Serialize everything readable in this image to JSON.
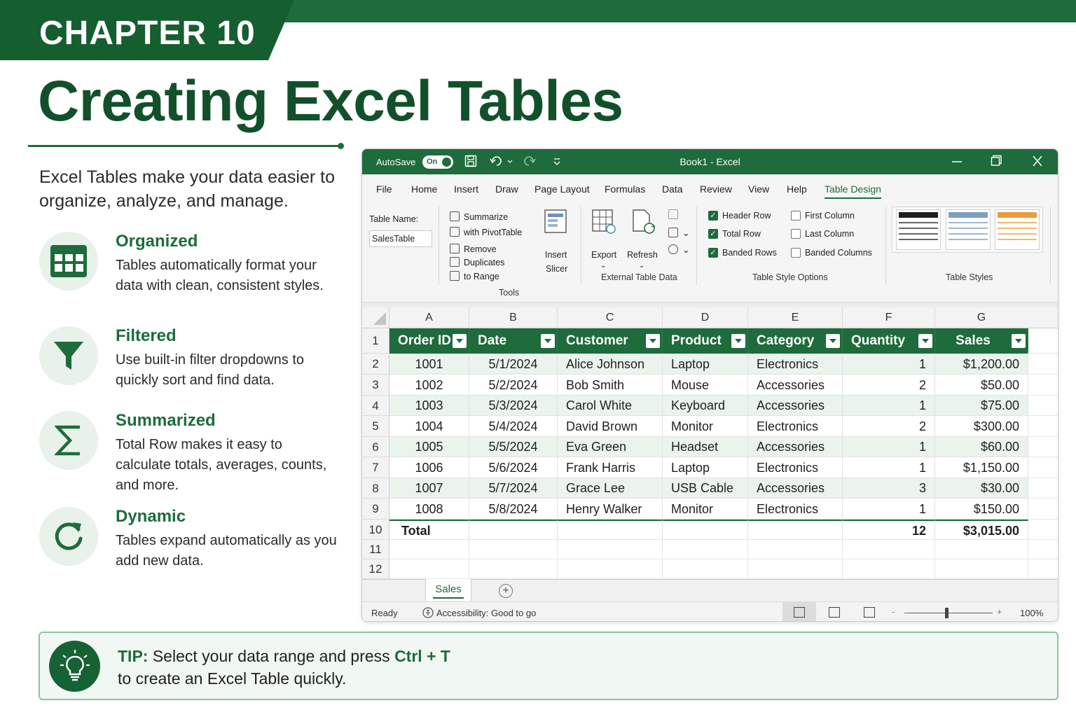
{
  "header": {
    "chapter": "CHAPTER 10",
    "title": "Creating Excel Tables"
  },
  "intro": "Excel Tables make your data easier to organize, analyze, and manage.",
  "features": [
    {
      "title": "Organized",
      "desc": "Tables automatically format your data with clean, consistent styles.",
      "icon": "table-grid-icon"
    },
    {
      "title": "Filtered",
      "desc": "Use built-in filter dropdowns to quickly sort and find data.",
      "icon": "filter-funnel-icon"
    },
    {
      "title": "Summarized",
      "desc": "Total Row makes it easy to calculate totals, averages, counts, and more.",
      "icon": "sigma-icon"
    },
    {
      "title": "Dynamic",
      "desc": "Tables expand automatically as you add new data.",
      "icon": "refresh-icon"
    }
  ],
  "excel": {
    "autosave_label": "AutoSave",
    "autosave_state": "On",
    "doc_title": "Book1  -  Excel",
    "menu": [
      "File",
      "Home",
      "Insert",
      "Draw",
      "Page Layout",
      "Formulas",
      "Data",
      "Review",
      "View",
      "Help",
      "Table Design"
    ],
    "active_menu": "Table Design",
    "ribbon": {
      "table_name_label": "Table Name:",
      "table_name_value": "SalesTable",
      "tools": {
        "summarize": "Summarize",
        "with_pivot": "with PivotTable",
        "remove": "Remove",
        "duplicates": "Duplicates",
        "to_range": "to Range",
        "insert_slicer_1": "Insert",
        "insert_slicer_2": "Slicer",
        "group_label": "Tools"
      },
      "external": {
        "export": "Export",
        "refresh": "Refresh",
        "group_label": "External Table Data"
      },
      "style_options": {
        "header_row": "Header Row",
        "total_row": "Total Row",
        "banded_rows": "Banded Rows",
        "first_column": "First Column",
        "last_column": "Last Column",
        "banded_columns": "Banded Columns",
        "group_label": "Table Style Options",
        "checked": {
          "header_row": true,
          "total_row": true,
          "banded_rows": true,
          "first_column": false,
          "last_column": false,
          "banded_columns": false
        }
      },
      "table_styles": {
        "group_label": "Table Styles",
        "swatches": [
          "#1f1f1f",
          "#7e9fc2",
          "#ec9a3c"
        ]
      }
    },
    "grid": {
      "columns": [
        "A",
        "B",
        "C",
        "D",
        "E",
        "F",
        "G"
      ],
      "rows": [
        "1",
        "2",
        "3",
        "4",
        "5",
        "6",
        "7",
        "8",
        "9",
        "10",
        "11",
        "12"
      ],
      "headers": [
        "Order ID",
        "Date",
        "Customer",
        "Product",
        "Category",
        "Quantity",
        "Sales"
      ],
      "data": [
        [
          "1001",
          "5/1/2024",
          "Alice Johnson",
          "Laptop",
          "Electronics",
          "1",
          "$1,200.00"
        ],
        [
          "1002",
          "5/2/2024",
          "Bob Smith",
          "Mouse",
          "Accessories",
          "2",
          "$50.00"
        ],
        [
          "1003",
          "5/3/2024",
          "Carol White",
          "Keyboard",
          "Accessories",
          "1",
          "$75.00"
        ],
        [
          "1004",
          "5/4/2024",
          "David Brown",
          "Monitor",
          "Electronics",
          "2",
          "$300.00"
        ],
        [
          "1005",
          "5/5/2024",
          "Eva Green",
          "Headset",
          "Accessories",
          "1",
          "$60.00"
        ],
        [
          "1006",
          "5/6/2024",
          "Frank Harris",
          "Laptop",
          "Electronics",
          "1",
          "$1,150.00"
        ],
        [
          "1007",
          "5/7/2024",
          "Grace Lee",
          "USB Cable",
          "Accessories",
          "3",
          "$30.00"
        ],
        [
          "1008",
          "5/8/2024",
          "Henry Walker",
          "Monitor",
          "Electronics",
          "1",
          "$150.00"
        ]
      ],
      "total": [
        "Total",
        "",
        "",
        "",
        "",
        "12",
        "$3,015.00"
      ]
    },
    "sheet_tab": "Sales",
    "status": {
      "ready": "Ready",
      "accessibility": "Accessibility: Good to go",
      "zoom": "100%"
    }
  },
  "tip": {
    "label": "TIP:",
    "text_before": "Select your data range and press",
    "shortcut": "Ctrl + T",
    "line2": "to create an Excel Table quickly."
  },
  "colors": {
    "brand_green": "#1e6b3c",
    "dark_green": "#12502b",
    "band_green": "#eaf3ec"
  }
}
